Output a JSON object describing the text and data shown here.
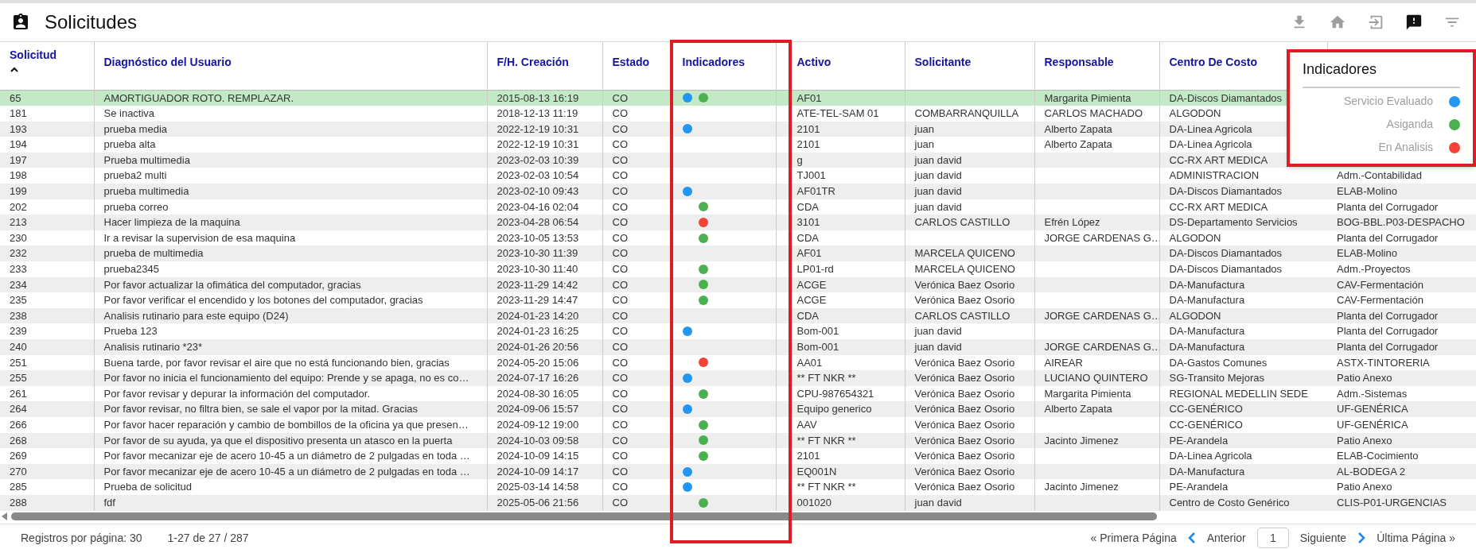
{
  "title": "Solicitudes",
  "toolbar": [
    {
      "kind": "download",
      "selected": false
    },
    {
      "kind": "home",
      "selected": false
    },
    {
      "kind": "exit",
      "selected": false
    },
    {
      "kind": "feedback",
      "selected": true
    },
    {
      "kind": "filter",
      "selected": false
    }
  ],
  "table": {
    "columns": [
      {
        "label": "Solicitud",
        "sorted": true
      },
      {
        "label": "Diagnóstico del Usuario"
      },
      {
        "label": "F/H. Creación"
      },
      {
        "label": "Estado"
      },
      {
        "label": "Indicadores"
      },
      {
        "label": "Activo"
      },
      {
        "label": "Solicitante"
      },
      {
        "label": "Responsable"
      },
      {
        "label": "Centro De Costo"
      }
    ],
    "rows": [
      {
        "solicitud": "65",
        "diagnostico": "AMORTIGUADOR ROTO. REMPLAZAR.",
        "fecha": "2015-08-13 16:19",
        "estado": "CO",
        "indicadores": [
          {
            "kind": "evaluado",
            "color": "#2196f3"
          },
          {
            "kind": "asignada",
            "color": "#4caf50"
          }
        ],
        "activo": "AF01",
        "responsable": "Margarita Pimienta",
        "centro_de_costo": "DA-Discos Diamantados",
        "selected": true
      },
      {
        "solicitud": "181",
        "diagnostico": "Se inactiva",
        "fecha": "2018-12-13 11:19",
        "estado": "CO",
        "indicadores": [],
        "activo": "ATE-TEL-SAM 01",
        "solicitante": "COMBARRANQUILLA",
        "responsable": "CARLOS MACHADO",
        "centro_de_costo": "ALGODON",
        "selected": false
      },
      {
        "solicitud": "193",
        "diagnostico": "prueba media",
        "fecha": "2022-12-19 10:31",
        "estado": "CO",
        "indicadores": [
          {
            "kind": "evaluado",
            "color": "#2196f3"
          }
        ],
        "activo": "2101",
        "solicitante": "juan",
        "responsable": "Alberto Zapata",
        "centro_de_costo": "DA-Linea Agricola",
        "selected": false
      },
      {
        "solicitud": "194",
        "diagnostico": "prueba alta",
        "fecha": "2022-12-19 10:31",
        "estado": "CO",
        "indicadores": [],
        "activo": "2101",
        "solicitante": "juan",
        "responsable": "Alberto Zapata",
        "centro_de_costo": "DA-Linea Agricola",
        "selected": false
      },
      {
        "solicitud": "197",
        "diagnostico": "Prueba multimedia",
        "fecha": "2023-02-03 10:39",
        "estado": "CO",
        "indicadores": [],
        "activo": "g",
        "solicitante": "juan david",
        "centro_de_costo": "CC-RX ART MEDICA",
        "selected": false
      },
      {
        "solicitud": "198",
        "diagnostico": "prueba2 multi",
        "fecha": "2023-02-03 10:54",
        "estado": "CO",
        "indicadores": [],
        "activo": "TJ001",
        "solicitante": "juan david",
        "centro_de_costo": "ADMINISTRACION",
        "column_10": "Adm.-Contabilidad",
        "selected": false
      },
      {
        "solicitud": "199",
        "diagnostico": "prueba multimedia",
        "fecha": "2023-02-10 09:43",
        "estado": "CO",
        "indicadores": [
          {
            "kind": "evaluado",
            "color": "#2196f3"
          }
        ],
        "activo": "AF01TR",
        "solicitante": "juan david",
        "centro_de_costo": "DA-Discos Diamantados",
        "column_10": "ELAB-Molino",
        "selected": false
      },
      {
        "solicitud": "202",
        "diagnostico": "prueba correo",
        "fecha": "2023-04-16 02:04",
        "estado": "CO",
        "indicadores": [
          {
            "kind": "asignada",
            "color": "#4caf50"
          }
        ],
        "activo": "CDA",
        "solicitante": "juan david",
        "centro_de_costo": "CC-RX ART MEDICA",
        "column_10": "Planta del Corrugador",
        "selected": false
      },
      {
        "solicitud": "213",
        "diagnostico": "Hacer limpieza de la maquina",
        "fecha": "2023-04-28 06:54",
        "estado": "CO",
        "indicadores": [
          {
            "kind": "analisis",
            "color": "#f44336"
          }
        ],
        "activo": "3101",
        "solicitante": "CARLOS CASTILLO",
        "responsable": "Efrén López",
        "centro_de_costo": "DS-Departamento Servicios",
        "column_10": "BOG-BBL.P03-DESPACHO",
        "selected": false
      },
      {
        "solicitud": "230",
        "diagnostico": "Ir a revisar la supervision de esa maquina",
        "fecha": "2023-10-05 13:53",
        "estado": "CO",
        "indicadores": [
          {
            "kind": "asignada",
            "color": "#4caf50"
          }
        ],
        "activo": "CDA",
        "responsable": "JORGE CARDENAS G…",
        "centro_de_costo": "ALGODON",
        "column_10": "Planta del Corrugador",
        "selected": false
      },
      {
        "solicitud": "232",
        "diagnostico": "prueba de multimedia",
        "fecha": "2023-10-30 11:39",
        "estado": "CO",
        "indicadores": [],
        "activo": "AF01",
        "solicitante": "MARCELA QUICENO",
        "centro_de_costo": "DA-Discos Diamantados",
        "column_10": "ELAB-Molino",
        "selected": false
      },
      {
        "solicitud": "233",
        "diagnostico": "prueba2345",
        "fecha": "2023-10-30 11:40",
        "estado": "CO",
        "indicadores": [
          {
            "kind": "asignada",
            "color": "#4caf50"
          }
        ],
        "activo": "LP01-rd",
        "solicitante": "MARCELA QUICENO",
        "centro_de_costo": "DA-Discos Diamantados",
        "column_10": "Adm.-Proyectos",
        "selected": false
      },
      {
        "solicitud": "234",
        "diagnostico": "Por favor actualizar la ofimática del computador, gracias",
        "fecha": "2023-11-29 14:42",
        "estado": "CO",
        "indicadores": [
          {
            "kind": "asignada",
            "color": "#4caf50"
          }
        ],
        "activo": "ACGE",
        "solicitante": "Verónica Baez Osorio",
        "centro_de_costo": "DA-Manufactura",
        "column_10": "CAV-Fermentación",
        "selected": false
      },
      {
        "solicitud": "235",
        "diagnostico": "Por favor verificar el encendido y los botones del computador, gracias",
        "fecha": "2023-11-29 14:47",
        "estado": "CO",
        "indicadores": [
          {
            "kind": "asignada",
            "color": "#4caf50"
          }
        ],
        "activo": "ACGE",
        "solicitante": "Verónica Baez Osorio",
        "centro_de_costo": "DA-Manufactura",
        "column_10": "CAV-Fermentación",
        "selected": false
      },
      {
        "solicitud": "238",
        "diagnostico": "Analisis rutinario para este equipo (D24)",
        "fecha": "2024-01-23 14:20",
        "estado": "CO",
        "indicadores": [],
        "activo": "CDA",
        "solicitante": "CARLOS CASTILLO",
        "responsable": "JORGE CARDENAS G…",
        "centro_de_costo": "ALGODON",
        "column_10": "Planta del Corrugador",
        "selected": false
      },
      {
        "solicitud": "239",
        "diagnostico": "Prueba 123",
        "fecha": "2024-01-23 16:25",
        "estado": "CO",
        "indicadores": [
          {
            "kind": "evaluado",
            "color": "#2196f3"
          }
        ],
        "activo": "Bom-001",
        "solicitante": "juan david",
        "centro_de_costo": "DA-Manufactura",
        "column_10": "Planta del Corrugador",
        "selected": false
      },
      {
        "solicitud": "240",
        "diagnostico": "Analisis rutinario *23*",
        "fecha": "2024-01-26 20:56",
        "estado": "CO",
        "indicadores": [],
        "activo": "Bom-001",
        "solicitante": "juan david",
        "responsable": "JORGE CARDENAS G…",
        "centro_de_costo": "DA-Manufactura",
        "column_10": "Planta del Corrugador",
        "selected": false
      },
      {
        "solicitud": "251",
        "diagnostico": "Buena tarde, por favor revisar el aire que no está funcionando bien, gracias",
        "fecha": "2024-05-20 15:06",
        "estado": "CO",
        "indicadores": [
          {
            "kind": "analisis",
            "color": "#f44336"
          }
        ],
        "activo": "AA01",
        "solicitante": "Verónica Baez Osorio",
        "responsable": "AIREAR",
        "centro_de_costo": "DA-Gastos Comunes",
        "column_10": "ASTX-TINTORERIA",
        "selected": false
      },
      {
        "solicitud": "255",
        "diagnostico": "Por favor no inicia el funcionamiento del equipo: Prende y se apaga, no es co…",
        "fecha": "2024-07-17 16:26",
        "estado": "CO",
        "indicadores": [
          {
            "kind": "evaluado",
            "color": "#2196f3"
          }
        ],
        "activo": "** FT NKR **",
        "solicitante": "Verónica Baez Osorio",
        "responsable": "LUCIANO QUINTERO",
        "centro_de_costo": "SG-Transito Mejoras",
        "column_10": "Patio Anexo",
        "selected": false
      },
      {
        "solicitud": "261",
        "diagnostico": "Por favor revisar y depurar la información del computador.",
        "fecha": "2024-08-30 16:05",
        "estado": "CO",
        "indicadores": [
          {
            "kind": "asignada",
            "color": "#4caf50"
          }
        ],
        "activo": "CPU-987654321",
        "solicitante": "Verónica Baez Osorio",
        "responsable": "Margarita Pimienta",
        "centro_de_costo": "REGIONAL MEDELLIN SEDE",
        "column_10": "Adm.-Sistemas",
        "selected": false
      },
      {
        "solicitud": "264",
        "diagnostico": "Por favor revisar, no filtra bien, se sale el vapor por la mitad. Gracias",
        "fecha": "2024-09-06 15:57",
        "estado": "CO",
        "indicadores": [
          {
            "kind": "evaluado",
            "color": "#2196f3"
          }
        ],
        "activo": "Equipo generico",
        "solicitante": "Verónica Baez Osorio",
        "responsable": "Alberto Zapata",
        "centro_de_costo": "CC-GENÉRICO",
        "column_10": "UF-GENÉRICA",
        "selected": false
      },
      {
        "solicitud": "266",
        "diagnostico": "Por favor hacer reparación y cambio de bombillos de la oficina ya que presen…",
        "fecha": "2024-09-12 19:00",
        "estado": "CO",
        "indicadores": [
          {
            "kind": "asignada",
            "color": "#4caf50"
          }
        ],
        "activo": "AAV",
        "solicitante": "Verónica Baez Osorio",
        "centro_de_costo": "CC-GENÉRICO",
        "column_10": "UF-GENÉRICA",
        "selected": false
      },
      {
        "solicitud": "268",
        "diagnostico": "Por favor de su ayuda, ya que el dispositivo presenta un atasco en la puerta",
        "fecha": "2024-10-03 09:58",
        "estado": "CO",
        "indicadores": [
          {
            "kind": "asignada",
            "color": "#4caf50"
          }
        ],
        "activo": "** FT NKR **",
        "solicitante": "Verónica Baez Osorio",
        "responsable": "Jacinto Jimenez",
        "centro_de_costo": "PE-Arandela",
        "column_10": "Patio Anexo",
        "selected": false
      },
      {
        "solicitud": "269",
        "diagnostico": "Por favor mecanizar eje de acero 10-45 a un diámetro de 2 pulgadas en toda …",
        "fecha": "2024-10-09 14:15",
        "estado": "CO",
        "indicadores": [
          {
            "kind": "asignada",
            "color": "#4caf50"
          }
        ],
        "activo": "2101",
        "solicitante": "Verónica Baez Osorio",
        "centro_de_costo": "DA-Linea Agricola",
        "column_10": "ELAB-Cocimiento",
        "selected": false
      },
      {
        "solicitud": "270",
        "diagnostico": "Por favor mecanizar eje de acero 10-45 a un diámetro de 2 pulgadas en toda …",
        "fecha": "2024-10-09 14:17",
        "estado": "CO",
        "indicadores": [
          {
            "kind": "evaluado",
            "color": "#2196f3"
          }
        ],
        "activo": "EQ001N",
        "solicitante": "Verónica Baez Osorio",
        "centro_de_costo": "DA-Manufactura",
        "column_10": "AL-BODEGA 2",
        "selected": false
      },
      {
        "solicitud": "285",
        "diagnostico": "Prueba de solicitud",
        "fecha": "2025-03-14 14:58",
        "estado": "CO",
        "indicadores": [
          {
            "kind": "evaluado",
            "color": "#2196f3"
          }
        ],
        "activo": "** FT NKR **",
        "solicitante": "Verónica Baez Osorio",
        "responsable": "Jacinto Jimenez",
        "centro_de_costo": "PE-Arandela",
        "column_10": "Patio Anexo",
        "selected": false
      },
      {
        "solicitud": "288",
        "diagnostico": "fdf",
        "fecha": "2025-05-06 21:56",
        "estado": "CO",
        "indicadores": [
          {
            "kind": "asignada",
            "color": "#4caf50"
          }
        ],
        "activo": "001020",
        "solicitante": "juan david",
        "centro_de_costo": "Centro de Costo Genérico",
        "column_10": "CLIS-P01-URGENCIAS",
        "selected": false
      }
    ]
  },
  "legend": {
    "title": "Indicadores",
    "items": [
      {
        "label": "Servicio Evaluado",
        "color": "#2196f3"
      },
      {
        "label": "Asiganda",
        "color": "#4caf50"
      },
      {
        "label": "En Analisis",
        "color": "#f44336"
      }
    ]
  },
  "footer": {
    "per_page": "Registros por página: 30",
    "range": "1-27 de 27 / 287",
    "first": "« Primera Página",
    "previous": "Anterior",
    "page": "1",
    "next": "Siguiente",
    "last": "Última Página »"
  }
}
